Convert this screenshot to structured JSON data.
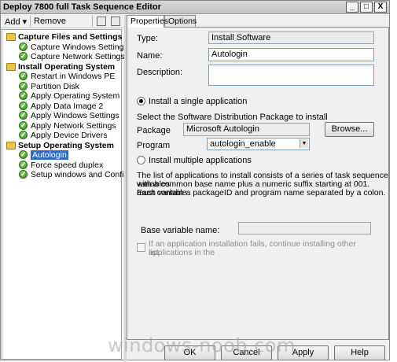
{
  "window": {
    "title": "Deploy 7800 full Task Sequence Editor",
    "controls": {
      "minimize": "_",
      "maximize": "□",
      "close": "X"
    }
  },
  "toolbar": {
    "add_label": "Add",
    "add_arrow": "▾",
    "remove_label": "Remove"
  },
  "tree": {
    "groups": [
      {
        "label": "Capture Files and Settings",
        "items": [
          "Capture Windows Settings",
          "Capture Network Settings"
        ]
      },
      {
        "label": "Install Operating System",
        "items": [
          "Restart in Windows PE",
          "Partition Disk",
          "Apply Operating System",
          "Apply Data Image 2",
          "Apply Windows Settings",
          "Apply Network Settings",
          "Apply Device Drivers"
        ]
      },
      {
        "label": "Setup Operating System",
        "items": [
          "Autologin",
          "Force speed duplex",
          "Setup windows and ConfigMgr"
        ]
      }
    ],
    "selected": "Autologin"
  },
  "tabs": [
    "Properties",
    "Options"
  ],
  "properties": {
    "type_label": "Type:",
    "type_value": "Install Software",
    "name_label": "Name:",
    "name_value": "Autologin",
    "description_label": "Description:",
    "description_value": "",
    "radio_single": "Install a single application",
    "select_pkg_text": "Select the Software Distribution Package to install",
    "package_label": "Package",
    "package_value": "Microsoft Autologin",
    "browse_label": "Browse...",
    "program_label": "Program",
    "program_value": "autologin_enable",
    "radio_multiple": "Install multiple applications",
    "multi_desc_1": "The list of applications to install consists of a series of task sequence variables",
    "multi_desc_2": "with a common base name plus a numeric suffix starting at 001.  Each variable",
    "multi_desc_3": "must contain a packageID and program name separated by a colon.",
    "base_var_label": "Base variable name:",
    "base_var_value": "",
    "continue_label_1": "If an application installation fails, continue installing other applications in the",
    "continue_label_2": "list."
  },
  "buttons": {
    "ok": "OK",
    "cancel": "Cancel",
    "apply": "Apply",
    "help": "Help"
  },
  "watermark": "windows-noob.com"
}
